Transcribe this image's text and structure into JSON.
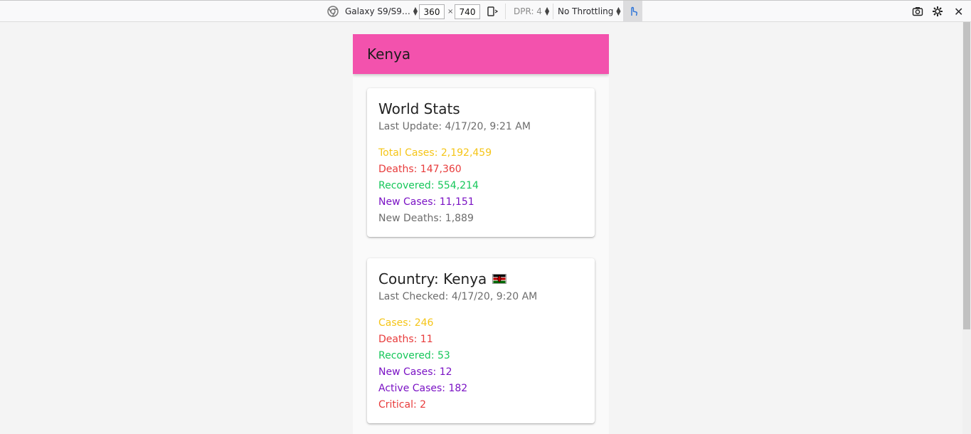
{
  "toolbar": {
    "device": "Galaxy S9/S9…",
    "width": "360",
    "height": "740",
    "times": "×",
    "dpr": "DPR: 4",
    "throttling": "No Throttling",
    "close": "✕"
  },
  "app": {
    "title": "Kenya",
    "colors": {
      "app_bar": "#f352ad",
      "yellow": "#f5c518",
      "red": "#e83b3b",
      "green": "#16c75a",
      "purple": "#7a12c4"
    }
  },
  "world": {
    "title": "World Stats",
    "last_update": "Last Update: 4/17/20, 9:21 AM",
    "total_cases": "Total Cases: 2,192,459",
    "deaths": "Deaths: 147,360",
    "recovered": "Recovered: 554,214",
    "new_cases": "New Cases: 11,151",
    "new_deaths": "New Deaths: 1,889"
  },
  "country": {
    "title": "Country: Kenya",
    "flag_icon": "kenya-flag-icon",
    "last_checked": "Last Checked: 4/17/20, 9:20 AM",
    "cases": "Cases: 246",
    "deaths": "Deaths: 11",
    "recovered": "Recovered: 53",
    "new_cases": "New Cases: 12",
    "active_cases": "Active Cases: 182",
    "critical": "Critical: 2"
  }
}
